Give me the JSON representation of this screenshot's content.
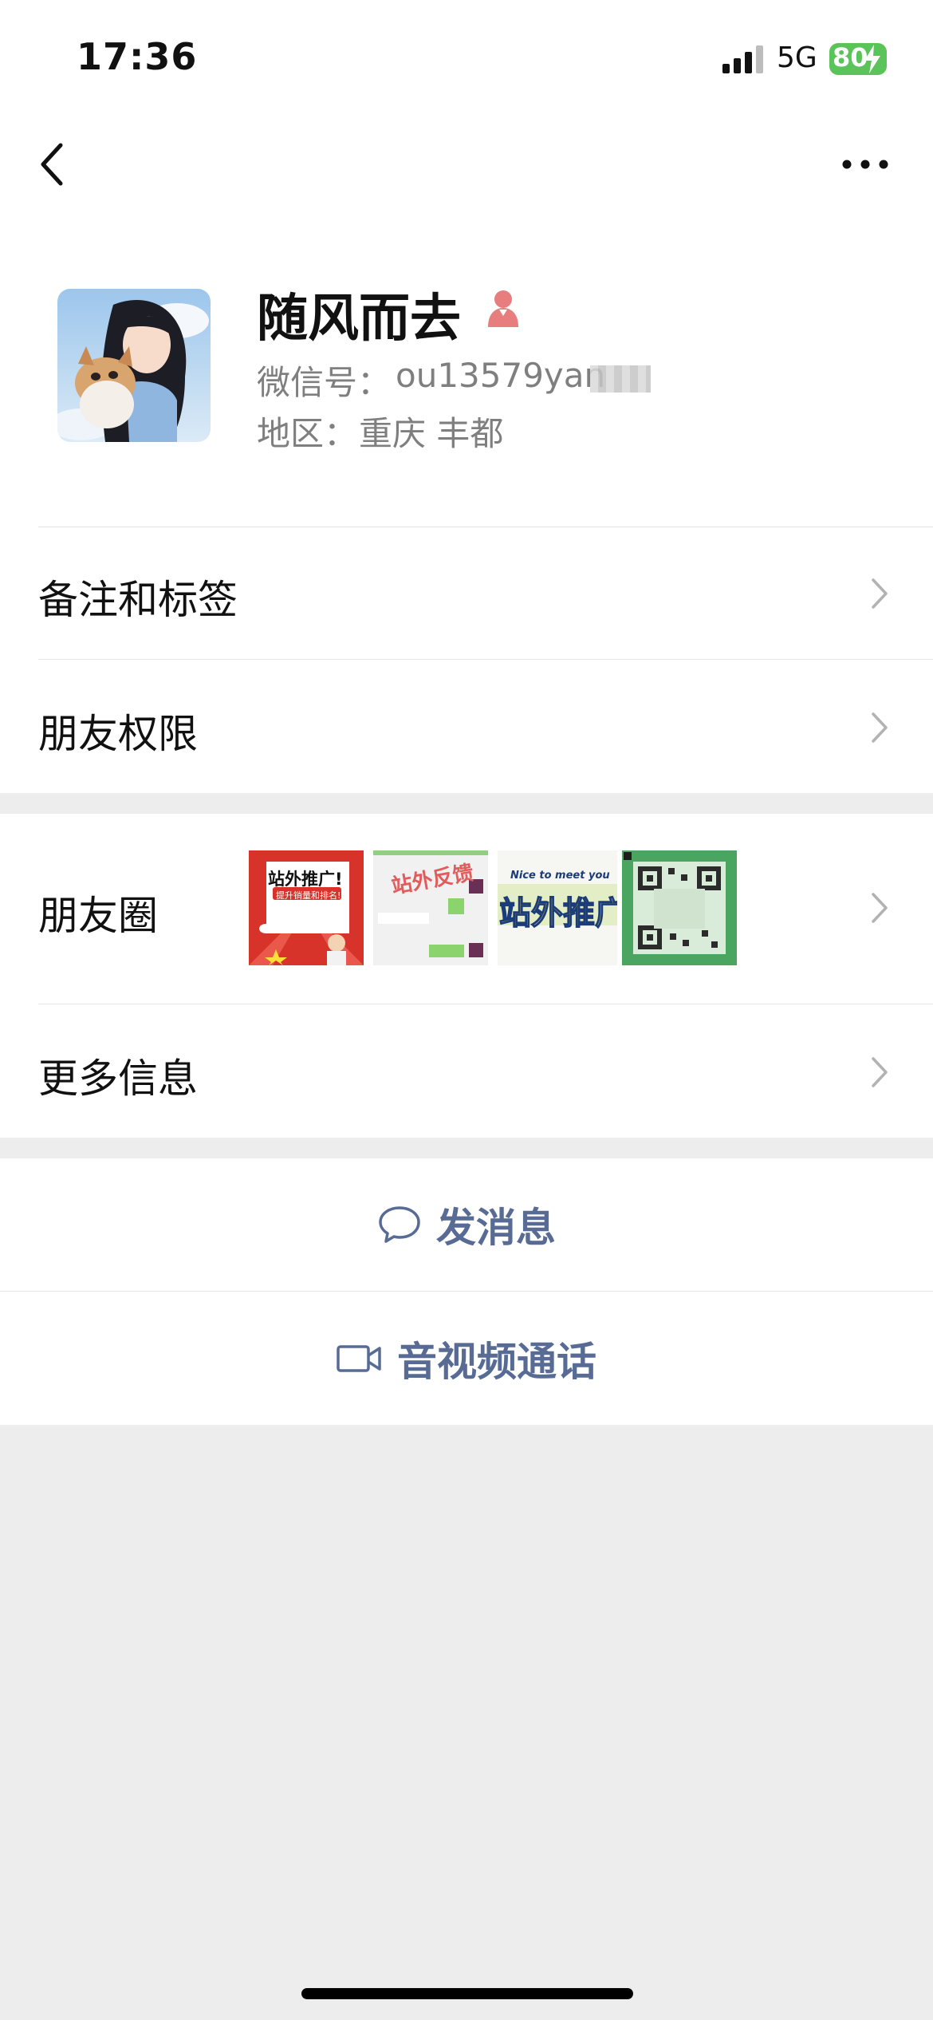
{
  "status_bar": {
    "time": "17:36",
    "network": "5G",
    "battery": "80"
  },
  "profile": {
    "nickname": "随风而去",
    "wechat_id_label": "微信号：",
    "wechat_id_value": "ou13579yan",
    "region_label": "地区：",
    "region_value": "重庆 丰都"
  },
  "rows": {
    "remarks_tags": "备注和标签",
    "friend_permissions": "朋友权限",
    "moments": "朋友圈",
    "more_info": "更多信息"
  },
  "moments_thumbs": {
    "t1_title": "站外推广!",
    "t1_sub": "提升销量和排名!",
    "t2_title": "站外反馈",
    "t3_top": "Nice to meet you",
    "t3_title": "站外推广"
  },
  "actions": {
    "send_message": "发消息",
    "voice_video_call": "音视频通话"
  },
  "colors": {
    "link_blue": "#576b95",
    "gender_female": "#e77d7d",
    "battery_green": "#5ac35a"
  }
}
